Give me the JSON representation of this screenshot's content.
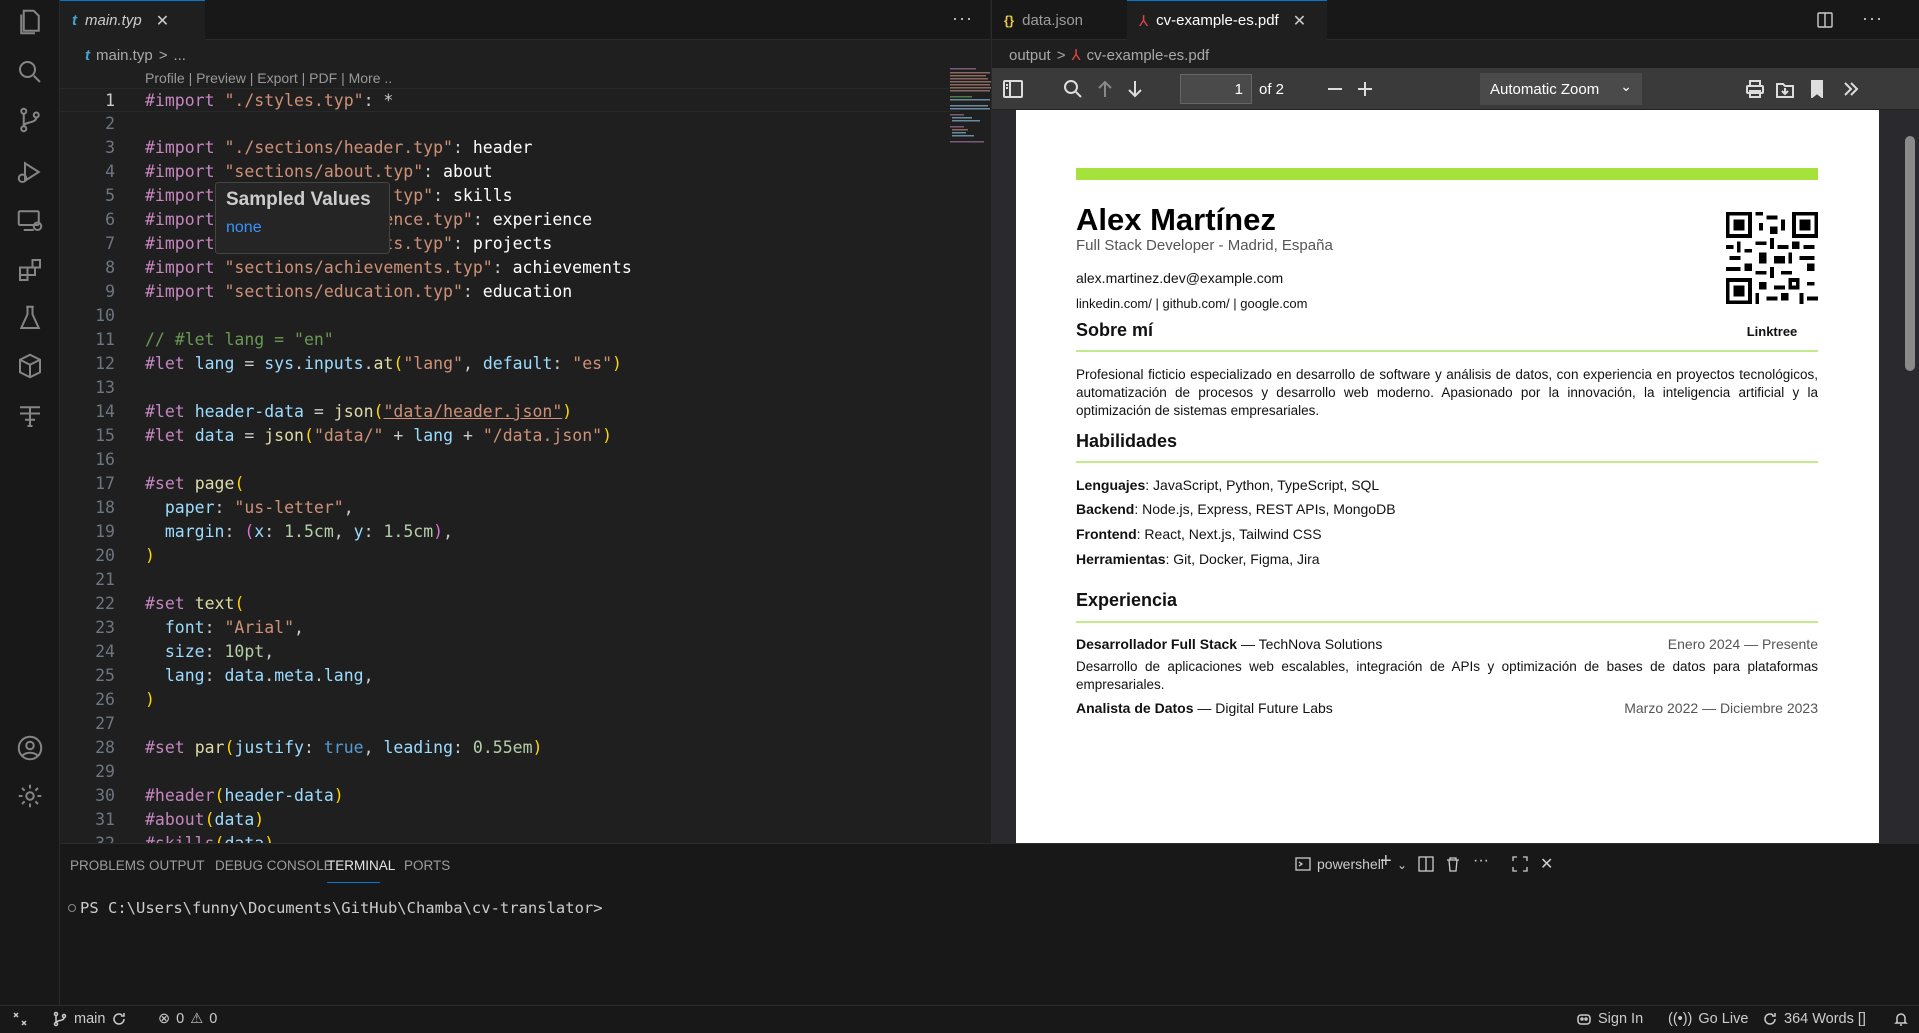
{
  "activity_bar": [
    "explorer-icon",
    "search-icon",
    "source-control-icon",
    "run-debug-icon",
    "remote-explorer-icon",
    "extensions-icon",
    "testing-icon",
    "containers-icon",
    "typst-icon",
    "account-icon",
    "settings-gear-icon"
  ],
  "editor1": {
    "tab": {
      "icon": "t",
      "label": "main.typ",
      "close": "✕"
    },
    "more": "···",
    "breadcrumb": {
      "icon": "t",
      "file": "main.typ",
      "sep": ">",
      "rest": "..."
    },
    "codelens": "Profile | Preview | Export | PDF | More ..",
    "lines": [
      "1",
      "2",
      "3",
      "4",
      "5",
      "6",
      "7",
      "8",
      "9",
      "10",
      "11",
      "12",
      "13",
      "14",
      "15",
      "16",
      "17",
      "18",
      "19",
      "20",
      "21",
      "22",
      "23",
      "24",
      "25",
      "26",
      "27",
      "28",
      "29",
      "30",
      "31",
      "32"
    ],
    "hover": {
      "title": "Sampled Values",
      "value": "none"
    }
  },
  "editor2": {
    "tabs": [
      {
        "icon": "{}",
        "label": "data.json"
      },
      {
        "icon": "pdf",
        "label": "cv-example-es.pdf",
        "close": "✕"
      }
    ],
    "breadcrumb": {
      "folder": "output",
      "sep": ">",
      "file": "cv-example-es.pdf"
    },
    "toolbar": {
      "page": "1",
      "of": "of 2",
      "zoom": "Automatic Zoom"
    }
  },
  "cv": {
    "name": "Alex Martínez",
    "subtitle": "Full Stack Developer - Madrid, España",
    "email": "alex.martinez.dev@example.com",
    "links": "linkedin.com/ | github.com/ | google.com",
    "qr_label": "Linktree",
    "about_title": "Sobre mí",
    "about_text": "Profesional ficticio especializado en desarrollo de software y análisis de datos, con experiencia en proyectos tecnológicos, automatización de procesos y desarrollo web moderno. Apasionado por la innovación, la inteligencia artificial y la optimización de sistemas empresariales.",
    "skills_title": "Habilidades",
    "skills": [
      {
        "k": "Lenguajes",
        "v": ": JavaScript, Python, TypeScript, SQL"
      },
      {
        "k": "Backend",
        "v": ": Node.js, Express, REST APIs, MongoDB"
      },
      {
        "k": "Frontend",
        "v": ": React, Next.js, Tailwind CSS"
      },
      {
        "k": "Herramientas",
        "v": ": Git, Docker, Figma, Jira"
      }
    ],
    "exp_title": "Experiencia",
    "exp": [
      {
        "role": "Desarrollador Full Stack",
        "company": " — TechNova Solutions",
        "date": "Enero 2024 — Presente",
        "desc": "Desarrollo de aplicaciones web escalables, integración de APIs y optimización de bases de datos para plataformas empresariales."
      },
      {
        "role": "Analista de Datos",
        "company": " — Digital Future Labs",
        "date": "Marzo 2022 — Diciembre 2023"
      }
    ]
  },
  "panel": {
    "tabs": [
      "PROBLEMS",
      "OUTPUT",
      "DEBUG CONSOLE",
      "TERMINAL",
      "PORTS"
    ],
    "active_tab": "TERMINAL",
    "shell": "powershell",
    "prompt": "PS C:\\Users\\funny\\Documents\\GitHub\\Chamba\\cv-translator>"
  },
  "status": {
    "branch": "main",
    "errors": "0",
    "warnings": "0",
    "sign_in": "Sign In",
    "go_live": "Go Live",
    "words": "364 Words []"
  },
  "colors": {
    "accent": "#0078d4",
    "cv_accent": "#a5e23c"
  }
}
